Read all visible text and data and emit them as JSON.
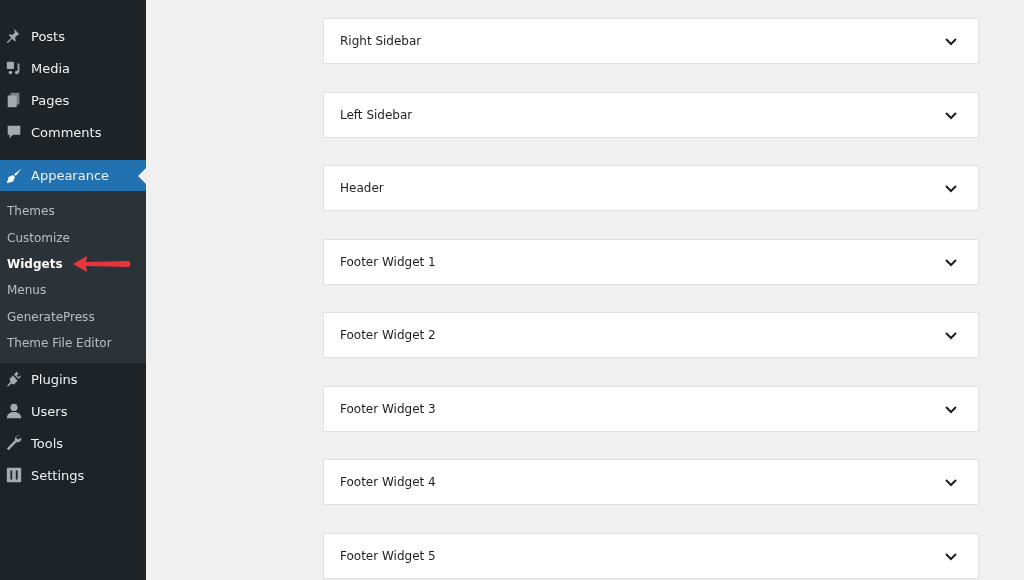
{
  "sidebar": {
    "items": [
      {
        "label": "Posts",
        "selected": false
      },
      {
        "label": "Media",
        "selected": false
      },
      {
        "label": "Pages",
        "selected": false
      },
      {
        "label": "Comments",
        "selected": false
      },
      {
        "label": "Appearance",
        "selected": true,
        "children": [
          {
            "label": "Themes",
            "selected": false
          },
          {
            "label": "Customize",
            "selected": false
          },
          {
            "label": "Widgets",
            "selected": true
          },
          {
            "label": "Menus",
            "selected": false
          },
          {
            "label": "GeneratePress",
            "selected": false
          },
          {
            "label": "Theme File Editor",
            "selected": false
          }
        ]
      },
      {
        "label": "Plugins",
        "selected": false
      },
      {
        "label": "Users",
        "selected": false
      },
      {
        "label": "Tools",
        "selected": false
      },
      {
        "label": "Settings",
        "selected": false
      }
    ]
  },
  "widget_areas": [
    {
      "title": "Right Sidebar",
      "expanded": false
    },
    {
      "title": "Left Sidebar",
      "expanded": false
    },
    {
      "title": "Header",
      "expanded": false
    },
    {
      "title": "Footer Widget 1",
      "expanded": false
    },
    {
      "title": "Footer Widget 2",
      "expanded": false
    },
    {
      "title": "Footer Widget 3",
      "expanded": false
    },
    {
      "title": "Footer Widget 4",
      "expanded": false
    },
    {
      "title": "Footer Widget 5",
      "expanded": false
    }
  ]
}
